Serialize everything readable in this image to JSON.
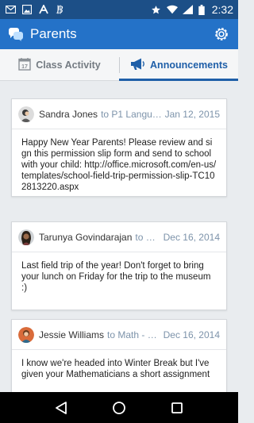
{
  "status_bar": {
    "time": "2:32",
    "icons": [
      "mail-icon",
      "image-icon",
      "a-app-icon",
      "b-app-icon",
      "star-icon",
      "wifi-icon",
      "signal-icon",
      "battery-icon"
    ]
  },
  "app_bar": {
    "title": "Parents",
    "logo_icon": "chat-bubbles-icon",
    "settings_icon": "gear-icon"
  },
  "tabs": [
    {
      "label": "Class Activity",
      "icon": "calendar-icon",
      "active": false
    },
    {
      "label": "Announcements",
      "icon": "megaphone-icon",
      "active": true
    }
  ],
  "posts": [
    {
      "author": "Sandra Jones",
      "to": "to P1 Langua...",
      "date": "Jan 12, 2015",
      "body": "Happy New Year Parents! Please review and sign this permission slip form and send to school with your child: http://office.microsoft.com/en-us/templates/school-field-trip-permission-slip-TC102813220.aspx"
    },
    {
      "author": "Tarunya Govindarajan",
      "to": "to Wo...",
      "date": "Dec 16, 2014",
      "body": "Last field trip of the year!  Don't forget to bring your lunch on Friday for the trip to the museum :)"
    },
    {
      "author": "Jessie Williams",
      "to": "to Math - Pe...",
      "date": "Dec 16, 2014",
      "body": "I know we're headed into Winter Break but I've given your Mathematicians a short assignment"
    }
  ],
  "colors": {
    "status_bar": "#1c4f87",
    "app_bar": "#2472c8",
    "active_tab": "#1f5fa8",
    "meta_text": "#7d93aa"
  }
}
